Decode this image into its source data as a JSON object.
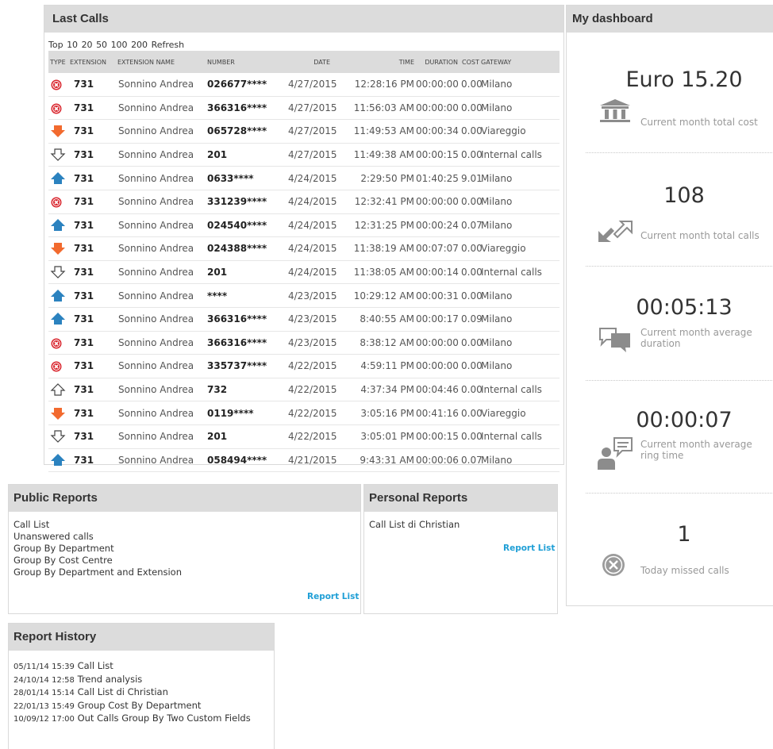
{
  "last_calls": {
    "title": "Last Calls",
    "top_links": [
      "Top",
      "10",
      "20",
      "50",
      "100",
      "200",
      "Refresh"
    ],
    "columns": [
      "TYPE",
      "EXTENSION",
      "EXTENSION NAME",
      "NUMBER",
      "DATE",
      "TIME",
      "DURATION",
      "COST",
      "GATEWAY"
    ],
    "rows": [
      {
        "type": "missed",
        "ext": "731",
        "name": "Sonnino Andrea",
        "number": "026677****",
        "date": "4/27/2015",
        "time": "12:28:16 PM",
        "duration": "00:00:00",
        "cost": "0.00",
        "gateway": "Milano"
      },
      {
        "type": "missed",
        "ext": "731",
        "name": "Sonnino Andrea",
        "number": "366316****",
        "date": "4/27/2015",
        "time": "11:56:03 AM",
        "duration": "00:00:00",
        "cost": "0.00",
        "gateway": "Milano"
      },
      {
        "type": "in",
        "ext": "731",
        "name": "Sonnino Andrea",
        "number": "065728****",
        "date": "4/27/2015",
        "time": "11:49:53 AM",
        "duration": "00:00:34",
        "cost": "0.00",
        "gateway": "Viareggio"
      },
      {
        "type": "internal-in",
        "ext": "731",
        "name": "Sonnino Andrea",
        "number": "201",
        "date": "4/27/2015",
        "time": "11:49:38 AM",
        "duration": "00:00:15",
        "cost": "0.00",
        "gateway": "Internal calls"
      },
      {
        "type": "out",
        "ext": "731",
        "name": "Sonnino Andrea",
        "number": "0633****",
        "date": "4/24/2015",
        "time": "2:29:50 PM",
        "duration": "01:40:25",
        "cost": "9.01",
        "gateway": "Milano"
      },
      {
        "type": "missed",
        "ext": "731",
        "name": "Sonnino Andrea",
        "number": "331239****",
        "date": "4/24/2015",
        "time": "12:32:41 PM",
        "duration": "00:00:00",
        "cost": "0.00",
        "gateway": "Milano"
      },
      {
        "type": "out",
        "ext": "731",
        "name": "Sonnino Andrea",
        "number": "024540****",
        "date": "4/24/2015",
        "time": "12:31:25 PM",
        "duration": "00:00:24",
        "cost": "0.07",
        "gateway": "Milano"
      },
      {
        "type": "in",
        "ext": "731",
        "name": "Sonnino Andrea",
        "number": "024388****",
        "date": "4/24/2015",
        "time": "11:38:19 AM",
        "duration": "00:07:07",
        "cost": "0.00",
        "gateway": "Viareggio"
      },
      {
        "type": "internal-in",
        "ext": "731",
        "name": "Sonnino Andrea",
        "number": "201",
        "date": "4/24/2015",
        "time": "11:38:05 AM",
        "duration": "00:00:14",
        "cost": "0.00",
        "gateway": "Internal calls"
      },
      {
        "type": "out",
        "ext": "731",
        "name": "Sonnino Andrea",
        "number": "****",
        "date": "4/23/2015",
        "time": "10:29:12 AM",
        "duration": "00:00:31",
        "cost": "0.00",
        "gateway": "Milano"
      },
      {
        "type": "out",
        "ext": "731",
        "name": "Sonnino Andrea",
        "number": "366316****",
        "date": "4/23/2015",
        "time": "8:40:55 AM",
        "duration": "00:00:17",
        "cost": "0.09",
        "gateway": "Milano"
      },
      {
        "type": "missed",
        "ext": "731",
        "name": "Sonnino Andrea",
        "number": "366316****",
        "date": "4/23/2015",
        "time": "8:38:12 AM",
        "duration": "00:00:00",
        "cost": "0.00",
        "gateway": "Milano"
      },
      {
        "type": "missed",
        "ext": "731",
        "name": "Sonnino Andrea",
        "number": "335737****",
        "date": "4/22/2015",
        "time": "4:59:11 PM",
        "duration": "00:00:00",
        "cost": "0.00",
        "gateway": "Milano"
      },
      {
        "type": "internal-out",
        "ext": "731",
        "name": "Sonnino Andrea",
        "number": "732",
        "date": "4/22/2015",
        "time": "4:37:34 PM",
        "duration": "00:04:46",
        "cost": "0.00",
        "gateway": "Internal calls"
      },
      {
        "type": "in",
        "ext": "731",
        "name": "Sonnino Andrea",
        "number": "0119****",
        "date": "4/22/2015",
        "time": "3:05:16 PM",
        "duration": "00:41:16",
        "cost": "0.00",
        "gateway": "Viareggio"
      },
      {
        "type": "internal-in",
        "ext": "731",
        "name": "Sonnino Andrea",
        "number": "201",
        "date": "4/22/2015",
        "time": "3:05:01 PM",
        "duration": "00:00:15",
        "cost": "0.00",
        "gateway": "Internal calls"
      },
      {
        "type": "out",
        "ext": "731",
        "name": "Sonnino Andrea",
        "number": "058494****",
        "date": "4/21/2015",
        "time": "9:43:31 AM",
        "duration": "00:00:06",
        "cost": "0.07",
        "gateway": "Milano"
      }
    ]
  },
  "dashboard": {
    "title": "My dashboard",
    "kpis": [
      {
        "value": "Euro 15.20",
        "label": "Current month total cost",
        "icon": "bank-icon"
      },
      {
        "value": "108",
        "label": "Current month total calls",
        "icon": "call-arrows-icon"
      },
      {
        "value": "00:05:13",
        "label": "Current month average duration",
        "icon": "chat-bubbles-icon"
      },
      {
        "value": "00:00:07",
        "label": "Current month average ring time",
        "icon": "person-chat-icon"
      },
      {
        "value": "1",
        "label": "Today missed calls",
        "icon": "missed-circle-icon"
      }
    ]
  },
  "public_reports": {
    "title": "Public Reports",
    "items": [
      "Call List",
      "Unanswered calls",
      "Group By Department",
      "Group By Cost Centre",
      "Group By Department and Extension"
    ],
    "link": "Report List"
  },
  "personal_reports": {
    "title": "Personal Reports",
    "items": [
      "Call List di Christian"
    ],
    "link": "Report List"
  },
  "report_history": {
    "title": "Report History",
    "items": [
      {
        "ts": "05/11/14 15:39",
        "name": "Call List"
      },
      {
        "ts": "24/10/14 12:58",
        "name": "Trend analysis"
      },
      {
        "ts": "28/01/14 15:14",
        "name": "Call List di Christian"
      },
      {
        "ts": "22/01/13 15:49",
        "name": "Group Cost By Department"
      },
      {
        "ts": "10/09/12 17:00",
        "name": "Out Calls Group By Two Custom Fields"
      }
    ]
  },
  "colors": {
    "missed": "#d9262e",
    "incoming": "#f26a2e",
    "outgoing": "#2b82bf",
    "link": "#1f9fd6",
    "header_bg": "#dcdcdc"
  }
}
